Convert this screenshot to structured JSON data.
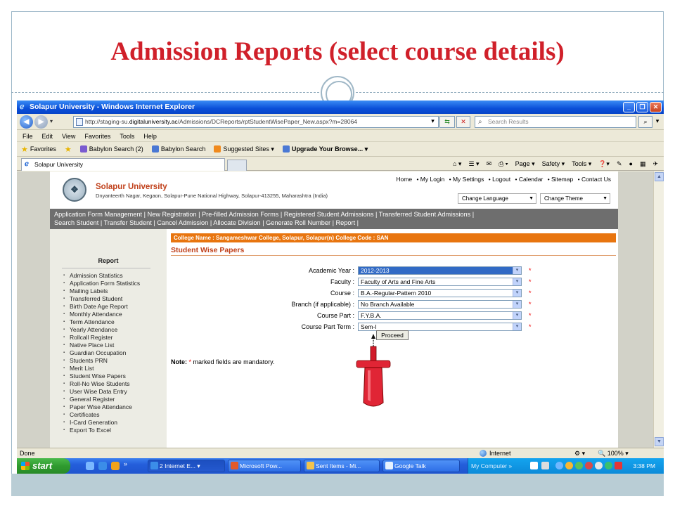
{
  "slide": {
    "title": "Admission Reports (select course details)"
  },
  "browser": {
    "window_title": "Solapur University - Windows Internet Explorer",
    "address_prefix": "http://staging-su.",
    "address_domain": "digitaluniversity.ac",
    "address_path": "/Admissions/DCReports/rptStudentWisePaper_New.aspx?m=28064",
    "search_placeholder": "Search Results",
    "menu": [
      "File",
      "Edit",
      "View",
      "Favorites",
      "Tools",
      "Help"
    ],
    "favorites": {
      "label": "Favorites",
      "items": [
        "Babylon Search (2)",
        "Babylon Search",
        "Suggested Sites ▾",
        "Upgrade Your Browse... ▾"
      ]
    },
    "tab_label": "Solapur University",
    "command_bar": [
      "Page ▾",
      "Safety ▾",
      "Tools ▾"
    ],
    "status": {
      "left": "Done",
      "zone": "Internet",
      "zoom": "🔍 100%  ▾"
    }
  },
  "site": {
    "university_name": "Solapur University",
    "university_address": "Dnyanteerth Nagar, Kegaon, Solapur-Pune National Highway, Solapur-413255, Maharashtra (India)",
    "top_links": [
      "Home",
      "• My Login",
      "• My Settings",
      "• Logout",
      "• Calendar",
      "• Sitemap",
      "• Contact Us"
    ],
    "change_language": "Change Language",
    "change_theme": "Change Theme",
    "nav_line1": "Application Form Management | New Registration | Pre-filled Admission Forms | Registered Student Admissions | Transferred Student Admissions |",
    "nav_line2": "Search Student | Transfer Student | Cancel Admission | Allocate Division | Generate Roll Number | Report |",
    "report_heading": "Report",
    "report_items": [
      "Admission Statistics",
      "Application Form Statistics",
      "Mailing Labels",
      "Transferred Student",
      "Birth Date Age Report",
      "Monthly Attendance",
      "Term Attendance",
      "Yearly Attendance",
      "Rollcall Register",
      "Native Place List",
      "Guardian Occupation",
      "Students PRN",
      "Merit List",
      "Student Wise Papers",
      "Roll-No Wise Students",
      "User Wise Data Entry",
      "General Register",
      "Paper Wise Attendance",
      "Certificates",
      "I-Card Generation",
      "Export To Excel"
    ],
    "college_label": "College Name :",
    "college_name": "Sangameshwar College, Solapur, Solapur(n)",
    "college_code_label": "College Code :",
    "college_code": "SAN",
    "form_title": "Student Wise Papers",
    "fields": [
      {
        "label": "Academic Year :",
        "value": "2012-2013"
      },
      {
        "label": "Faculty :",
        "value": "Faculty of Arts and Fine Arts"
      },
      {
        "label": "Course :",
        "value": "B.A.-Regular-Pattern 2010"
      },
      {
        "label": "Branch (if applicable) :",
        "value": "No Branch Available"
      },
      {
        "label": "Course Part :",
        "value": "F.Y.B.A."
      },
      {
        "label": "Course Part Term :",
        "value": "Sem-I"
      }
    ],
    "required_mark": "*",
    "proceed_label": "Proceed",
    "note_bold": "Note:",
    "note_star": "*",
    "note_text": "marked fields are mandatory."
  },
  "taskbar": {
    "start_label": "start",
    "tasks": [
      "2 Internet E... ▾",
      "Microsoft Pow...",
      "Sent Items - Mi...",
      "Google Talk"
    ],
    "tray_label": "My Computer  »",
    "clock": "3:38 PM"
  },
  "colors": {
    "slide_title": "#d0202a",
    "college_bar": "#e8750f",
    "form_title": "#c0401a",
    "nav_band": "#6e6e6e"
  }
}
